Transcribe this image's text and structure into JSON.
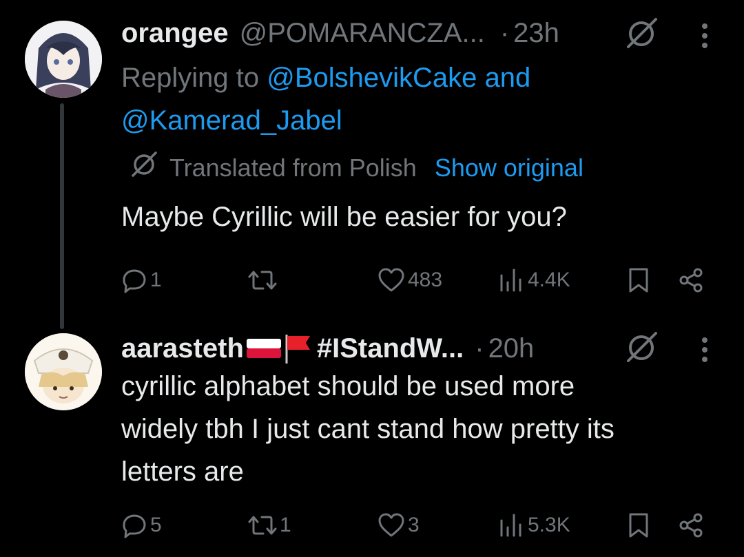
{
  "tweets": [
    {
      "display_name": "orangee",
      "handle": "@POMARANCZA...",
      "separator": "·",
      "time": "23h",
      "replying_prefix": "Replying to",
      "replying_mention_1": "@BolshevikCake",
      "replying_and": "and",
      "replying_mention_2": "@Kamerad_Jabel",
      "translated_label": "Translated from Polish",
      "show_original": "Show original",
      "text": "Maybe Cyrillic will be easier for you?",
      "stats": {
        "replies": "1",
        "reposts": "",
        "likes": "483",
        "views": "4.4K"
      }
    },
    {
      "display_name": "aarasteth",
      "hashtag": "#IStandW...",
      "separator": "·",
      "time": "20h",
      "text_line_1": "cyrillic alphabet should be used more",
      "text_line_2": "widely tbh I just cant stand how pretty its",
      "text_line_3": "letters are",
      "stats": {
        "replies": "5",
        "reposts": "1",
        "likes": "3",
        "views": "5.3K"
      }
    }
  ],
  "icons": {
    "grok": "grok-icon",
    "more": "more-vertical-icon",
    "reply": "reply-icon",
    "repost": "repost-icon",
    "like": "heart-icon",
    "views": "views-icon",
    "bookmark": "bookmark-icon",
    "share": "share-icon",
    "flag_poland": "poland-flag-icon",
    "flag_red": "red-flag-icon"
  },
  "colors": {
    "background": "#000000",
    "text": "#e7e9ea",
    "muted": "#71767b",
    "link": "#1d9bf0",
    "thread_line": "#333639"
  }
}
